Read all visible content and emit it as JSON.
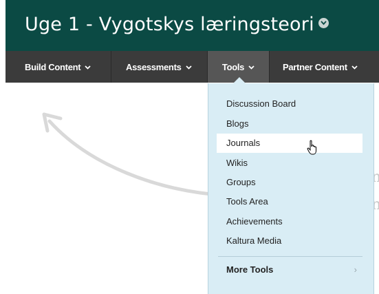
{
  "title_bar": {
    "title": "Uge 1 - Vygotskys læringsteori",
    "options_icon": "chevron-down-circle-icon",
    "background": "#0b4a44"
  },
  "nav": {
    "background": "#3b3b3b",
    "items": [
      {
        "label": "Build Content",
        "icon": "chevron-down-icon"
      },
      {
        "label": "Assessments",
        "icon": "chevron-down-icon"
      },
      {
        "label": "Tools",
        "icon": "chevron-down-icon",
        "active": true
      },
      {
        "label": "Partner Content",
        "icon": "chevron-down-icon"
      }
    ]
  },
  "background_text": {
    "line1": "n",
    "line2": "n"
  },
  "tools_menu": {
    "background": "#d9edf5",
    "items": [
      {
        "label": "Discussion Board"
      },
      {
        "label": "Blogs"
      },
      {
        "label": "Journals",
        "hovered": true
      },
      {
        "label": "Wikis"
      },
      {
        "label": "Groups"
      },
      {
        "label": "Tools Area"
      },
      {
        "label": "Achievements"
      },
      {
        "label": "Kaltura Media"
      }
    ],
    "more": {
      "label": "More Tools",
      "icon": "chevron-right-icon"
    }
  },
  "decor": {
    "arrow_icon": "curved-arrow-icon",
    "cursor_icon": "hand-pointer-icon"
  }
}
